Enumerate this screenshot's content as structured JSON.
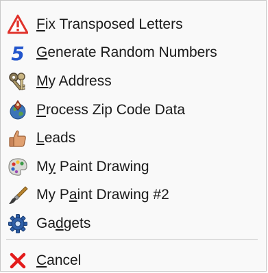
{
  "menu": {
    "items": [
      {
        "label_pre": "",
        "mnemonic": "F",
        "label_post": "ix Transposed Letters",
        "icon": "warning-triangle-icon"
      },
      {
        "label_pre": "",
        "mnemonic": "G",
        "label_post": "enerate Random Numbers",
        "icon": "number-five-icon"
      },
      {
        "label_pre": "",
        "mnemonic": "M",
        "label_post": "y Address",
        "icon": "keys-icon"
      },
      {
        "label_pre": "",
        "mnemonic": "P",
        "label_post": "rocess Zip Code Data",
        "icon": "globe-pin-icon"
      },
      {
        "label_pre": "",
        "mnemonic": "L",
        "label_post": "eads",
        "icon": "thumbs-up-icon"
      },
      {
        "label_pre": "M",
        "mnemonic": "y",
        "label_post": " Paint Drawing",
        "icon": "paint-palette-icon"
      },
      {
        "label_pre": "My P",
        "mnemonic": "a",
        "label_post": "int Drawing #2",
        "icon": "paintbrush-icon"
      },
      {
        "label_pre": "Ga",
        "mnemonic": "d",
        "label_post": "gets",
        "icon": "gear-icon"
      }
    ],
    "cancel": {
      "label_pre": "",
      "mnemonic": "C",
      "label_post": "ancel",
      "icon": "red-x-icon"
    }
  },
  "colors": {
    "warning_red": "#e0322b",
    "number_blue": "#2255cc",
    "cancel_red": "#e31b1b"
  }
}
